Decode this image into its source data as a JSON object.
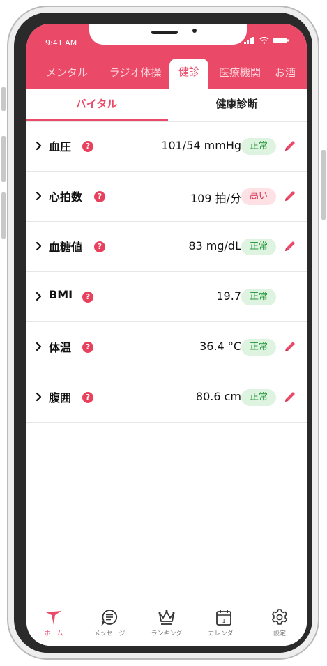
{
  "status_bar": {
    "time": "9:41 AM"
  },
  "top_tabs": [
    {
      "label": "メンタル",
      "active": false
    },
    {
      "label": "ラジオ体操",
      "active": false
    },
    {
      "label": "健診",
      "active": true
    },
    {
      "label": "医療機関",
      "active": false
    },
    {
      "label": "お酒",
      "active": false
    }
  ],
  "sub_tabs": [
    {
      "label": "バイタル",
      "active": true
    },
    {
      "label": "健康診断",
      "active": false
    }
  ],
  "vitals": [
    {
      "name": "血圧",
      "value": "101/54 mmHg",
      "status": "正常",
      "status_type": "normal",
      "editable": true
    },
    {
      "name": "心拍数",
      "value": "109 拍/分",
      "status": "高い",
      "status_type": "high",
      "editable": true
    },
    {
      "name": "血糖値",
      "value": "83 mg/dL",
      "status": "正常",
      "status_type": "normal",
      "editable": true
    },
    {
      "name": "BMI",
      "value": "19.7",
      "status": "正常",
      "status_type": "normal",
      "editable": false
    },
    {
      "name": "体温",
      "value": "36.4 °C",
      "status": "正常",
      "status_type": "normal",
      "editable": true
    },
    {
      "name": "腹囲",
      "value": "80.6 cm",
      "status": "正常",
      "status_type": "normal",
      "editable": true
    }
  ],
  "bottom_nav": [
    {
      "label": "ホーム",
      "icon": "home-icon",
      "active": true
    },
    {
      "label": "メッセージ",
      "icon": "message-icon",
      "active": false
    },
    {
      "label": "ランキング",
      "icon": "crown-icon",
      "active": false
    },
    {
      "label": "カレンダー",
      "icon": "calendar-icon",
      "active": false
    },
    {
      "label": "設定",
      "icon": "gear-icon",
      "active": false
    }
  ],
  "calendar_icon_text": "1",
  "help_icon_text": "?",
  "colors": {
    "accent": "#ea4a68",
    "normal_bg": "#dff3e1",
    "normal_text": "#2f9e44",
    "high_bg": "#fde1e5",
    "high_text": "#d6304d"
  }
}
